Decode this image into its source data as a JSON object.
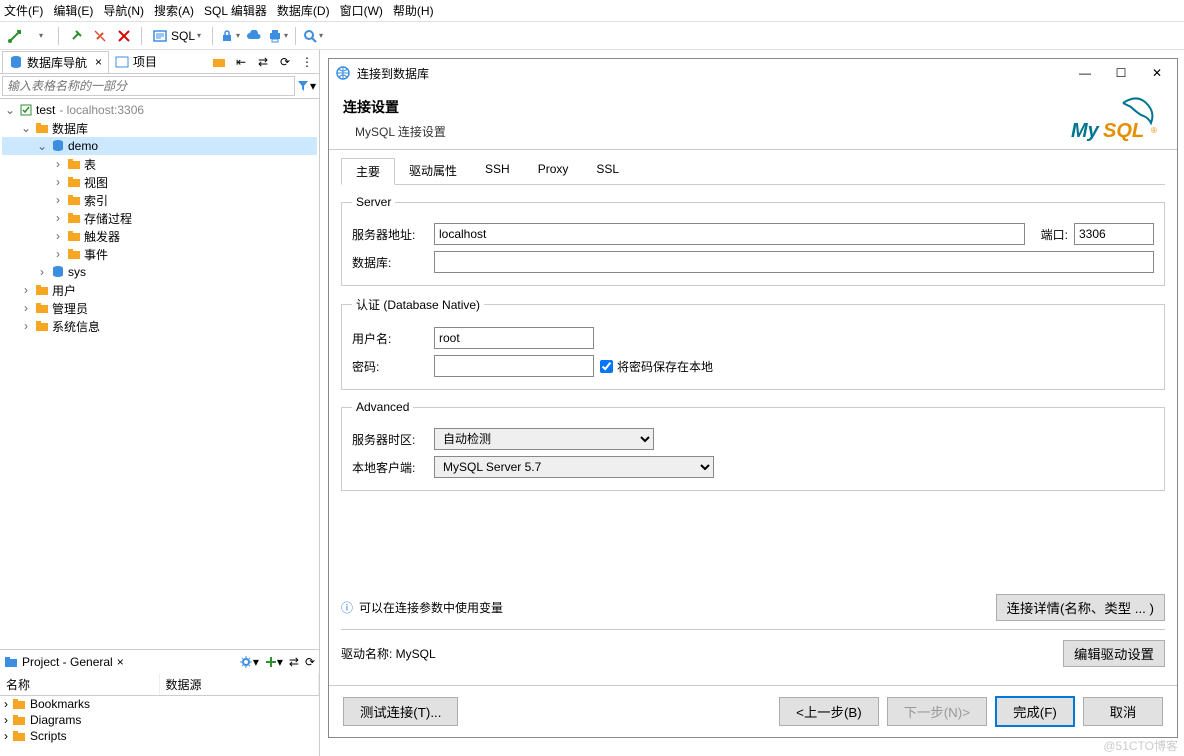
{
  "menubar": [
    "文件(F)",
    "编辑(E)",
    "导航(N)",
    "搜索(A)",
    "SQL 编辑器",
    "数据库(D)",
    "窗口(W)",
    "帮助(H)"
  ],
  "toolbar": {
    "sql_label": "SQL"
  },
  "nav": {
    "tab1": "数据库导航",
    "tab2": "项目",
    "filter_placeholder": "输入表格名称的一部分"
  },
  "tree": {
    "conn_name": "test",
    "conn_info": "- localhost:3306",
    "databases": "数据库",
    "demo": "demo",
    "tables": "表",
    "views": "视图",
    "indexes": "索引",
    "procedures": "存储过程",
    "triggers": "触发器",
    "events": "事件",
    "sys": "sys",
    "users": "用户",
    "admins": "管理员",
    "sysinfo": "系统信息"
  },
  "panel2": {
    "title": "Project - General",
    "col1": "名称",
    "col2": "数据源",
    "items": [
      "Bookmarks",
      "Diagrams",
      "Scripts"
    ]
  },
  "dialog": {
    "title": "连接到数据库",
    "h1": "连接设置",
    "sub": "MySQL 连接设置",
    "tabs": [
      "主要",
      "驱动属性",
      "SSH",
      "Proxy",
      "SSL"
    ],
    "server_legend": "Server",
    "host_label": "服务器地址:",
    "host_value": "localhost",
    "port_label": "端口:",
    "port_value": "3306",
    "db_label": "数据库:",
    "db_value": "",
    "auth_legend": "认证 (Database Native)",
    "user_label": "用户名:",
    "user_value": "root",
    "pass_label": "密码:",
    "pass_value": "",
    "save_pass": "将密码保存在本地",
    "adv_legend": "Advanced",
    "tz_label": "服务器时区:",
    "tz_value": "自动检测",
    "client_label": "本地客户端:",
    "client_value": "MySQL Server 5.7",
    "info": "可以在连接参数中使用变量",
    "details_btn": "连接详情(名称、类型 ... )",
    "driver_label": "驱动名称: MySQL",
    "edit_driver_btn": "编辑驱动设置",
    "test_btn": "测试连接(T)...",
    "back_btn": "<上一步(B)",
    "next_btn": "下一步(N)>",
    "finish_btn": "完成(F)",
    "cancel_btn": "取消"
  },
  "watermark": "@51CTO博客"
}
